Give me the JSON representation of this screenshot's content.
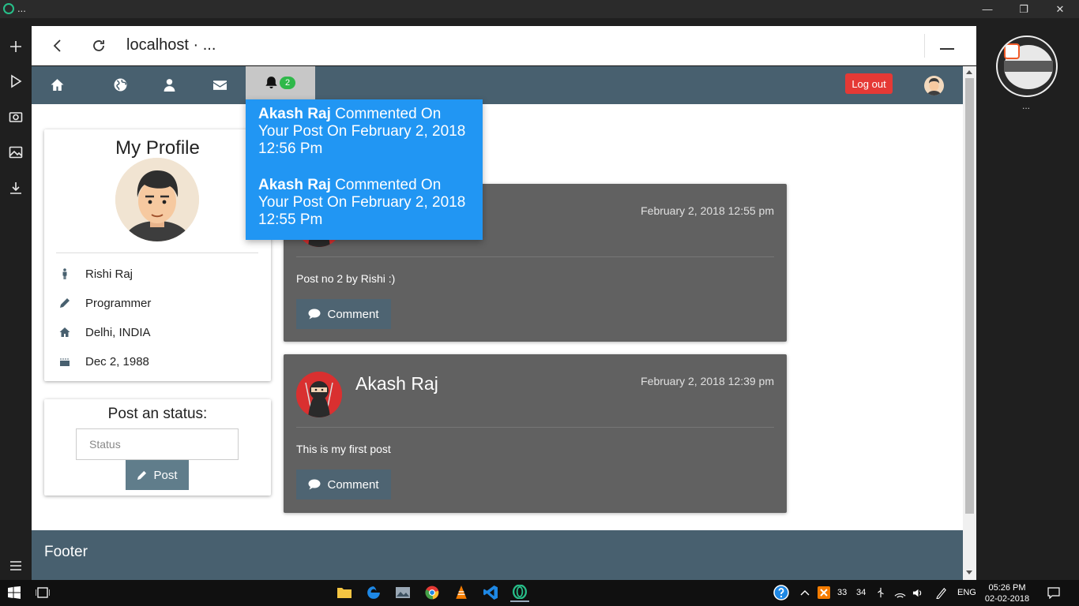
{
  "os": {
    "window_title": "...",
    "taskbar": {
      "tray_numbers": [
        "33",
        "34"
      ],
      "language": "ENG",
      "time": "05:26 PM",
      "date": "02-02-2018"
    }
  },
  "browser": {
    "url": "localhost",
    "url_suffix": "· ..."
  },
  "speed_dial": {
    "label": "..."
  },
  "site": {
    "notif_count": "2",
    "logout_label": "Log out",
    "notifications": [
      {
        "name": "Akash Raj",
        "text": " Commented On Your Post On February 2, 2018 12:56 Pm"
      },
      {
        "name": "Akash Raj",
        "text": " Commented On Your Post On February 2, 2018 12:55 Pm"
      }
    ],
    "profile": {
      "title": "My Profile",
      "name": "Rishi Raj",
      "occupation": "Programmer",
      "location": "Delhi, INDIA",
      "birthday": "Dec 2, 1988"
    },
    "status": {
      "title": "Post an status:",
      "placeholder": "Status",
      "post_label": "Post"
    },
    "posts": [
      {
        "author": "",
        "date": "February 2, 2018 12:55 pm",
        "content": "Post no 2 by Rishi :)",
        "comment_label": "Comment"
      },
      {
        "author": "Akash Raj",
        "date": "February 2, 2018 12:39 pm",
        "content": "This is my first post",
        "comment_label": "Comment"
      }
    ],
    "footer": "Footer"
  },
  "colors": {
    "nav_bg": "#48606f",
    "notif_bg": "#2196f3",
    "badge": "#2fb84a",
    "logout": "#e53935",
    "post_bg": "#616161",
    "button_bg": "#607d8b"
  }
}
